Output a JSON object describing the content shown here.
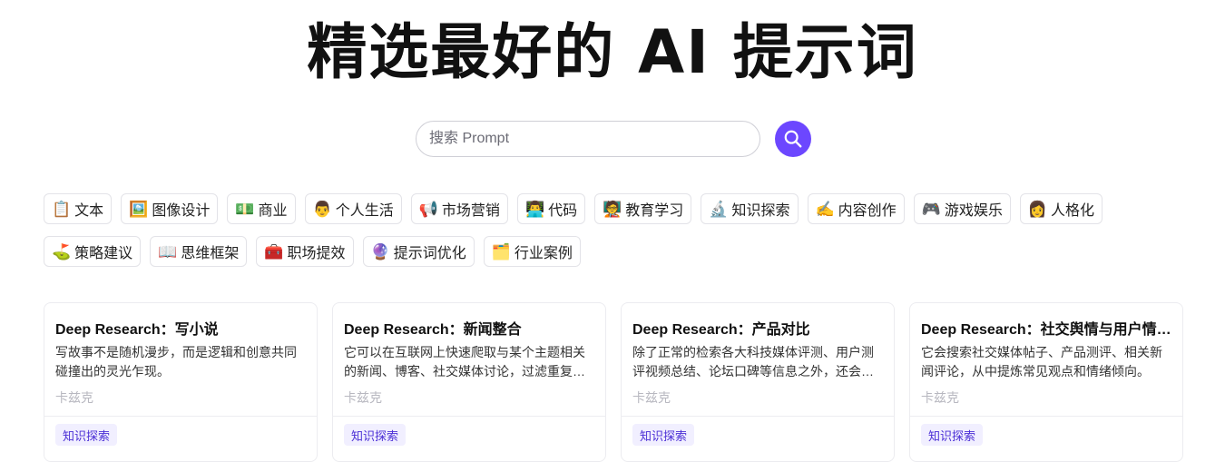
{
  "hero": {
    "title": "精选最好的 AI 提示词"
  },
  "search": {
    "placeholder": "搜索 Prompt",
    "button_icon": "search-icon",
    "accent": "#6c47ff"
  },
  "tags": {
    "row1": [
      {
        "emoji": "📋",
        "label": "文本"
      },
      {
        "emoji": "🖼️",
        "label": "图像设计"
      },
      {
        "emoji": "💵",
        "label": "商业"
      },
      {
        "emoji": "👨",
        "label": "个人生活"
      },
      {
        "emoji": "📢",
        "label": "市场营销"
      },
      {
        "emoji": "👨‍💻",
        "label": "代码"
      },
      {
        "emoji": "🧑‍🏫",
        "label": "教育学习"
      },
      {
        "emoji": "🔬",
        "label": "知识探索"
      },
      {
        "emoji": "✍️",
        "label": "内容创作"
      },
      {
        "emoji": "🎮",
        "label": "游戏娱乐"
      },
      {
        "emoji": "👩",
        "label": "人格化"
      }
    ],
    "row2": [
      {
        "emoji": "⛳",
        "label": "策略建议"
      },
      {
        "emoji": "📖",
        "label": "思维框架"
      },
      {
        "emoji": "🧰",
        "label": "职场提效"
      },
      {
        "emoji": "🔮",
        "label": "提示词优化"
      },
      {
        "emoji": "🗂️",
        "label": "行业案例"
      }
    ]
  },
  "cards": [
    {
      "title": "Deep Research：写小说",
      "desc": "写故事不是随机漫步，而是逻辑和创意共同碰撞出的灵光乍现。",
      "author": "卡兹克",
      "badge": "知识探索"
    },
    {
      "title": "Deep Research：新闻整合",
      "desc": "它可以在互联网上快速爬取与某个主题相关的新闻、博客、社交媒体讨论，过滤重复信息。",
      "author": "卡兹克",
      "badge": "知识探索"
    },
    {
      "title": "Deep Research：产品对比",
      "desc": "除了正常的检索各大科技媒体评测、用户测评视频总结、论坛口碑等信息之外，还会对比。",
      "author": "卡兹克",
      "badge": "知识探索"
    },
    {
      "title": "Deep Research：社交舆情与用户情绪分析",
      "desc": "它会搜索社交媒体帖子、产品测评、相关新闻评论，从中提炼常见观点和情绪倾向。",
      "author": "卡兹克",
      "badge": "知识探索"
    }
  ]
}
